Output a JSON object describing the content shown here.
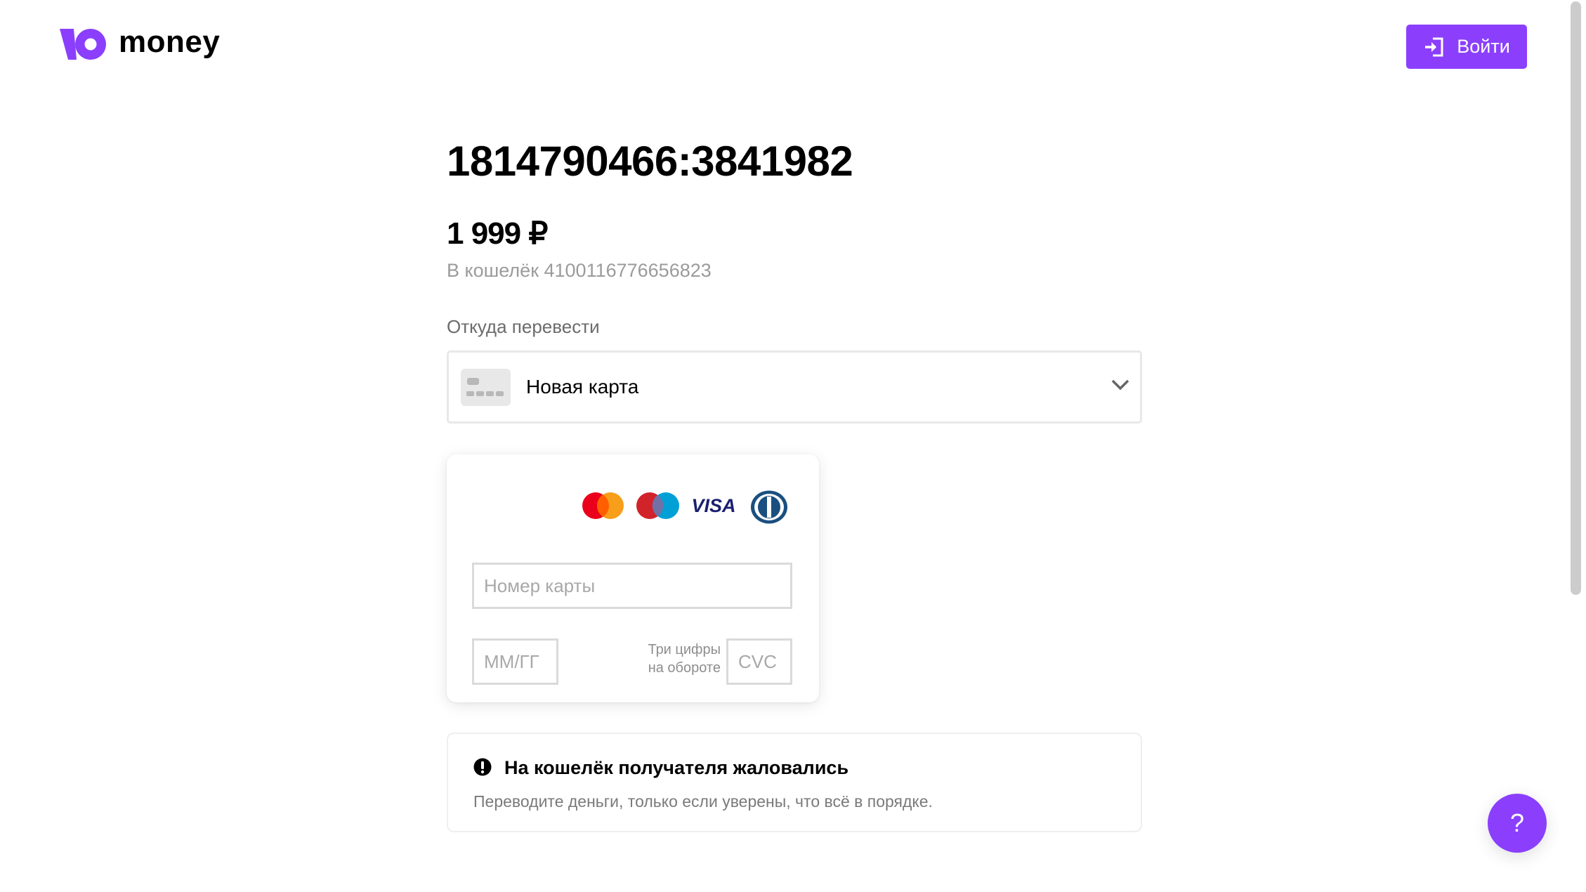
{
  "header": {
    "logo_text": "money",
    "login_label": "Войти",
    "brand_color": "#8b3ffd"
  },
  "payment": {
    "title": "1814790466:3841982",
    "amount": "1 999 ₽",
    "wallet_line": "В кошелёк 4100116776656823"
  },
  "source": {
    "label": "Откуда перевести",
    "selected": "Новая карта",
    "icon": "card-icon"
  },
  "card_form": {
    "brands": [
      "mastercard",
      "maestro",
      "visa",
      "diners-club"
    ],
    "visa_text": "VISA",
    "card_number": {
      "value": "",
      "placeholder": "Номер карты"
    },
    "expiry": {
      "value": "",
      "placeholder": "ММ/ГГ"
    },
    "cvc_hint_line1": "Три цифры",
    "cvc_hint_line2": "на обороте",
    "cvc": {
      "value": "",
      "placeholder": "CVC"
    }
  },
  "warning": {
    "icon": "exclamation-circle-icon",
    "title": "На кошелёк получателя жаловались",
    "text": "Переводите деньги, только если уверены, что всё в порядке."
  },
  "help": {
    "label": "?"
  }
}
